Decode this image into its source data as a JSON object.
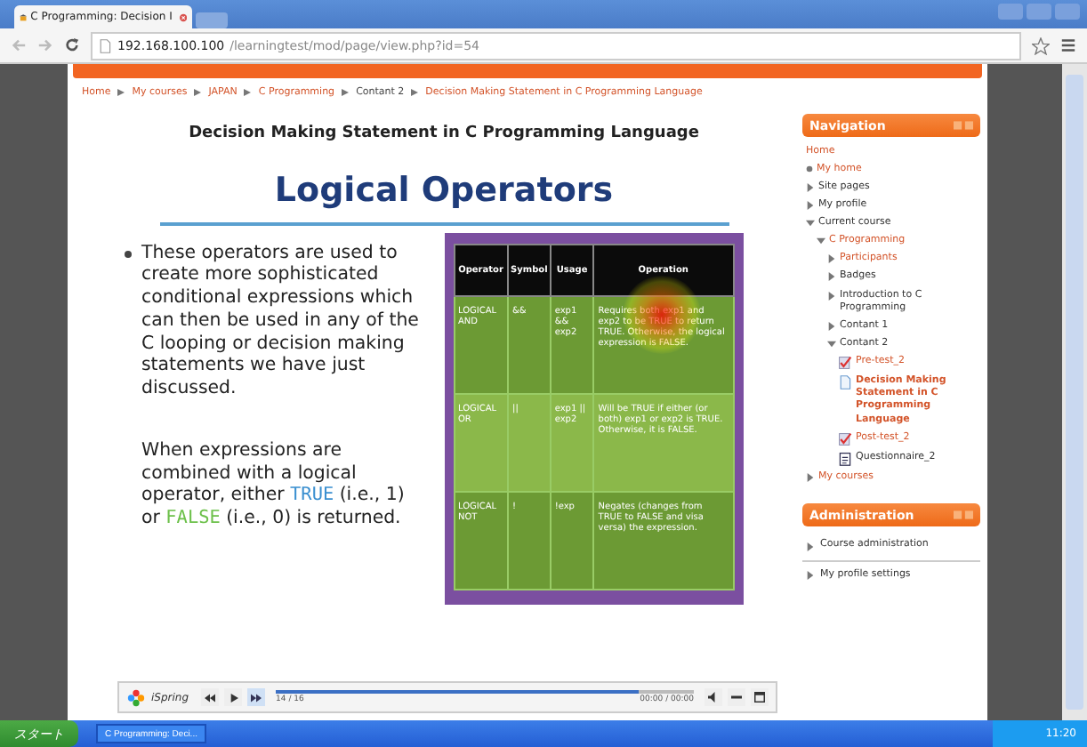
{
  "browser": {
    "tab_title": "C Programming: Decision I",
    "url_host": "192.168.100.100",
    "url_path": "/learningtest/mod/page/view.php?id=54"
  },
  "breadcrumb": [
    {
      "label": "Home",
      "link": true
    },
    {
      "label": "My courses",
      "link": true
    },
    {
      "label": "JAPAN",
      "link": true
    },
    {
      "label": "C Programming",
      "link": true
    },
    {
      "label": "Contant 2",
      "link": false
    },
    {
      "label": "Decision Making Statement in C Programming Language",
      "link": true
    }
  ],
  "slide": {
    "header": "Decision Making Statement in C Programming Language",
    "title": "Logical Operators",
    "bullet": "These operators are used to create more sophisticated conditional expressions which can then be used in any of the C looping or decision making statements we have just discussed.",
    "note": [
      {
        "kind": "plain",
        "text": "When expressions are combined with a logical operator, either "
      },
      {
        "kind": "code",
        "text": "TRUE",
        "color": "#3a8fd0"
      },
      {
        "kind": "plain",
        "text": " (i.e., 1) or "
      },
      {
        "kind": "code",
        "text": "FALSE",
        "color": "#6cc04a"
      },
      {
        "kind": "plain",
        "text": " (i.e., 0) is returned."
      }
    ],
    "table": {
      "columns": [
        "Operator",
        "Symbol",
        "Usage",
        "Operation"
      ],
      "rows": [
        [
          "LOGICAL AND",
          "&&",
          "exp1 && exp2",
          "Requires both exp1 and exp2 to be TRUE to return TRUE. Otherwise, the logical expression is FALSE."
        ],
        [
          "LOGICAL OR",
          "||",
          "exp1 || exp2",
          "Will be TRUE if either (or both) exp1 or exp2 is TRUE. Otherwise, it is FALSE."
        ],
        [
          "LOGICAL NOT",
          "!",
          "!exp",
          "Negates (changes from TRUE to FALSE and visa versa) the expression."
        ]
      ]
    }
  },
  "player": {
    "brand": "iSpring",
    "slide_counter": "14 / 16",
    "time": "00:00 / 00:00",
    "level": 0.87
  },
  "navigation": {
    "title": "Navigation",
    "items": [
      {
        "label": "Home",
        "kind": "plain",
        "link": true
      },
      {
        "label": "My home",
        "kind": "bullet",
        "link": true
      },
      {
        "label": "Site pages",
        "kind": "branch",
        "expanded": false,
        "link": false
      },
      {
        "label": "My profile",
        "kind": "branch",
        "expanded": false,
        "link": false
      },
      {
        "label": "Current course",
        "kind": "branch",
        "expanded": true,
        "link": false,
        "children": [
          {
            "label": "C Programming",
            "kind": "branch",
            "expanded": true,
            "link": true,
            "children": [
              {
                "label": "Participants",
                "kind": "branch",
                "expanded": false,
                "link": true
              },
              {
                "label": "Badges",
                "kind": "branch",
                "expanded": false,
                "link": false
              },
              {
                "label": "Introduction to C Programming",
                "kind": "branch",
                "expanded": false,
                "link": false
              },
              {
                "label": "Contant 1",
                "kind": "branch",
                "expanded": false,
                "link": false
              },
              {
                "label": "Contant 2",
                "kind": "branch",
                "expanded": true,
                "link": false,
                "children": [
                  {
                    "label": "Pre-test_2",
                    "kind": "quiz",
                    "link": true
                  },
                  {
                    "label": "Decision Making Statement in C Programming Language",
                    "kind": "page",
                    "link": true,
                    "current": true
                  },
                  {
                    "label": "Post-test_2",
                    "kind": "quiz",
                    "link": true
                  },
                  {
                    "label": "Questionnaire_2",
                    "kind": "questionnaire",
                    "link": false
                  }
                ]
              }
            ]
          }
        ]
      },
      {
        "label": "My courses",
        "kind": "branch",
        "expanded": false,
        "link": true
      }
    ]
  },
  "administration": {
    "title": "Administration",
    "items": [
      "Course administration",
      "My profile settings"
    ]
  },
  "taskbar": {
    "start": "スタート",
    "task": "C Programming: Deci...",
    "clock": "11:20"
  }
}
